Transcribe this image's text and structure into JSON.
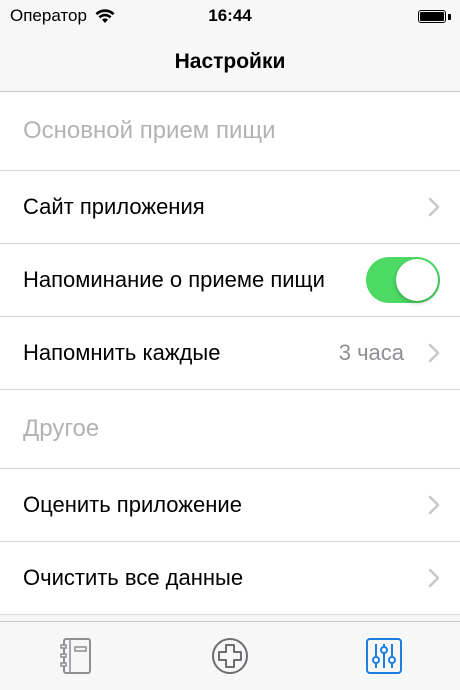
{
  "status_bar": {
    "carrier": "Оператор",
    "time": "16:44",
    "battery_level": 1.0
  },
  "nav": {
    "title": "Настройки"
  },
  "sections": {
    "main_header": "Основной прием пищи",
    "other_header": "Другое"
  },
  "rows": {
    "app_site": {
      "label": "Сайт приложения"
    },
    "meal_reminder": {
      "label": "Напоминание о приеме пищи",
      "enabled": true
    },
    "remind_every": {
      "label": "Напомнить каждые",
      "value": "3 часа"
    },
    "rate_app": {
      "label": "Оценить приложение"
    },
    "clear_data": {
      "label": "Очистить все данные"
    }
  },
  "tab_bar": {
    "tabs": [
      {
        "icon": "notebook-icon",
        "active": false
      },
      {
        "icon": "add-circle-icon",
        "active": false
      },
      {
        "icon": "settings-sliders-icon",
        "active": true
      }
    ],
    "active_color": "#1a7fe0",
    "inactive_color": "#8e8e93"
  },
  "colors": {
    "toggle_on": "#4cd964",
    "section_text": "#b3b3b3",
    "value_text": "#8e8e93"
  }
}
